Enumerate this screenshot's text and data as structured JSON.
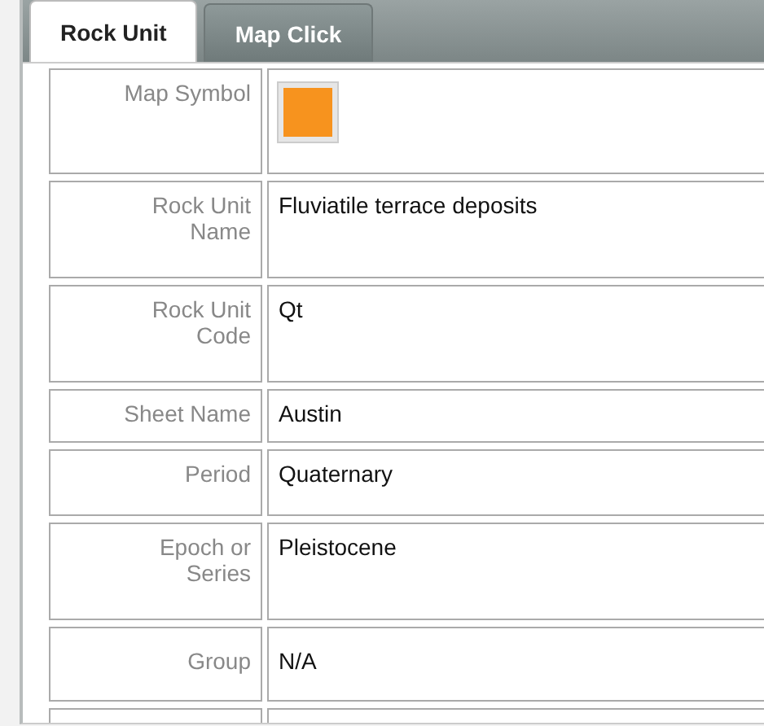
{
  "tabs": [
    {
      "label": "Rock Unit",
      "selected": true
    },
    {
      "label": "Map Click",
      "selected": false
    }
  ],
  "rows": [
    {
      "kind": "symbol",
      "label": "Map Symbol",
      "color": "#f7931e"
    },
    {
      "kind": "text",
      "label": "Rock Unit Name",
      "value": "Fluviatile terrace deposits"
    },
    {
      "kind": "text",
      "label": "Rock Unit Code",
      "value": "Qt"
    },
    {
      "kind": "text",
      "label": "Sheet Name",
      "value": "Austin"
    },
    {
      "kind": "text",
      "label": "Period",
      "value": "Quaternary"
    },
    {
      "kind": "text",
      "label": "Epoch or Series",
      "value": "Pleistocene"
    },
    {
      "kind": "text",
      "label": "Group",
      "value": "N/A"
    },
    {
      "kind": "empty"
    }
  ]
}
